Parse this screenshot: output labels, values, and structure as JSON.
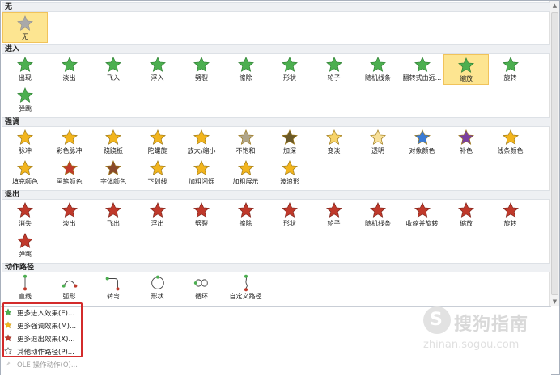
{
  "sections": {
    "none": "无",
    "entrance": "进入",
    "emphasis": "强调",
    "exit": "退出",
    "paths": "动作路径"
  },
  "none_item": "无",
  "entrance": [
    "出现",
    "淡出",
    "飞入",
    "浮入",
    "劈裂",
    "擦除",
    "形状",
    "轮子",
    "随机线条",
    "翻转式由远...",
    "缩放",
    "旋转",
    "弹跳"
  ],
  "emphasis": [
    "脉冲",
    "彩色脉冲",
    "跷跷板",
    "陀螺旋",
    "放大/缩小",
    "不饱和",
    "加深",
    "变淡",
    "透明",
    "对象颜色",
    "补色",
    "线条颜色",
    "填充颜色",
    "画笔颜色",
    "字体颜色",
    "下划线",
    "加粗闪烁",
    "加粗展示",
    "波浪形"
  ],
  "exit": [
    "消失",
    "淡出",
    "飞出",
    "浮出",
    "劈裂",
    "擦除",
    "形状",
    "轮子",
    "随机线条",
    "收缩并旋转",
    "缩放",
    "旋转",
    "弹跳"
  ],
  "paths": [
    "直线",
    "弧形",
    "转弯",
    "形状",
    "循环",
    "自定义路径"
  ],
  "menu": {
    "more_entrance": "更多进入效果(E)...",
    "more_emphasis": "更多强调效果(M)...",
    "more_exit": "更多退出效果(X)...",
    "other_paths": "其他动作路径(P)...",
    "ole_actions": "OLE 操作动作(O)..."
  },
  "watermark": {
    "brand": "搜狗指南",
    "url": "zhinan.sogou.com"
  },
  "colors": {
    "entrance": "#4caf50",
    "emphasis": "#f2b51e",
    "exit": "#c0392b",
    "selected": "#fde591",
    "selection_border": "#f1c35a",
    "callout": "#d32b2b"
  }
}
